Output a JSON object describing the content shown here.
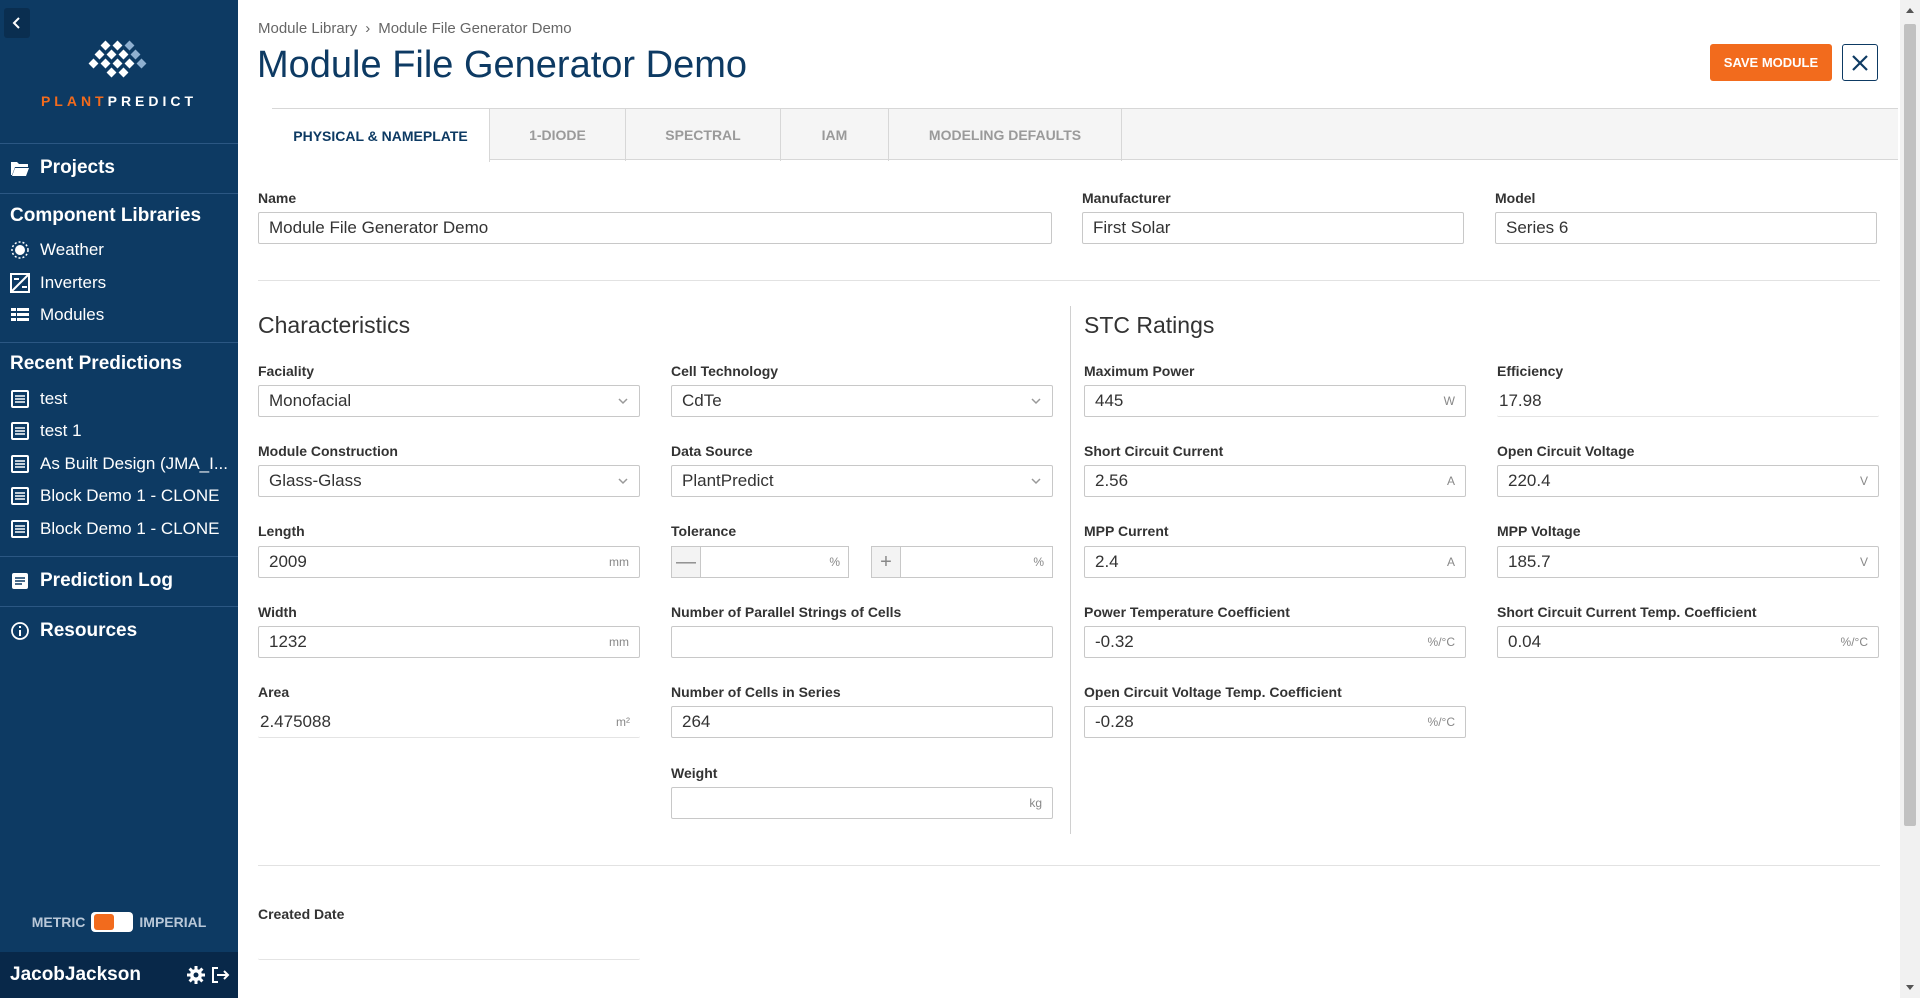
{
  "brand": {
    "name_part1": "PLANT",
    "name_part2": "PREDICT"
  },
  "sidebar": {
    "projects": "Projects",
    "component_libraries": "Component Libraries",
    "libraries": [
      {
        "label": "Weather",
        "icon": "sun-icon"
      },
      {
        "label": "Inverters",
        "icon": "inverter-icon"
      },
      {
        "label": "Modules",
        "icon": "modules-grid-icon"
      }
    ],
    "recent_predictions": "Recent Predictions",
    "recent": [
      "test",
      "test 1",
      "As Built Design (JMA_I...",
      "Block Demo 1 - CLONE",
      "Block Demo 1 - CLONE"
    ],
    "prediction_log": "Prediction Log",
    "resources": "Resources",
    "units": {
      "metric": "METRIC",
      "imperial": "IMPERIAL"
    },
    "user": "JacobJackson"
  },
  "breadcrumb": {
    "root": "Module Library",
    "current": "Module File Generator Demo"
  },
  "page_title": "Module File Generator Demo",
  "actions": {
    "save": "SAVE MODULE"
  },
  "tabs": [
    "PHYSICAL & NAMEPLATE",
    "1-DIODE",
    "SPECTRAL",
    "IAM",
    "MODELING DEFAULTS"
  ],
  "header_fields": {
    "name": {
      "label": "Name",
      "value": "Module File Generator Demo"
    },
    "manufacturer": {
      "label": "Manufacturer",
      "value": "First Solar"
    },
    "model": {
      "label": "Model",
      "value": "Series 6"
    }
  },
  "characteristics": {
    "title": "Characteristics",
    "faciality": {
      "label": "Faciality",
      "value": "Monofacial"
    },
    "cell_technology": {
      "label": "Cell Technology",
      "value": "CdTe"
    },
    "module_construction": {
      "label": "Module Construction",
      "value": "Glass-Glass"
    },
    "data_source": {
      "label": "Data Source",
      "value": "PlantPredict"
    },
    "length": {
      "label": "Length",
      "value": "2009",
      "unit": "mm"
    },
    "tolerance": {
      "label": "Tolerance",
      "unit": "%",
      "minus": "—",
      "plus": "+"
    },
    "width": {
      "label": "Width",
      "value": "1232",
      "unit": "mm"
    },
    "parallel_strings": {
      "label": "Number of Parallel Strings of Cells",
      "value": ""
    },
    "area": {
      "label": "Area",
      "value": "2.475088",
      "unit": "m²"
    },
    "cells_in_series": {
      "label": "Number of Cells in Series",
      "value": "264"
    },
    "weight": {
      "label": "Weight",
      "value": "",
      "unit": "kg"
    }
  },
  "stc": {
    "title": "STC Ratings",
    "max_power": {
      "label": "Maximum Power",
      "value": "445",
      "unit": "W"
    },
    "efficiency": {
      "label": "Efficiency",
      "value": "17.98"
    },
    "isc": {
      "label": "Short Circuit Current",
      "value": "2.56",
      "unit": "A"
    },
    "voc": {
      "label": "Open Circuit Voltage",
      "value": "220.4",
      "unit": "V"
    },
    "impp": {
      "label": "MPP Current",
      "value": "2.4",
      "unit": "A"
    },
    "vmpp": {
      "label": "MPP Voltage",
      "value": "185.7",
      "unit": "V"
    },
    "power_temp_coef": {
      "label": "Power Temperature Coefficient",
      "value": "-0.32",
      "unit": "%/°C"
    },
    "isc_temp_coef": {
      "label": "Short Circuit Current Temp. Coefficient",
      "value": "0.04",
      "unit": "%/°C"
    },
    "voc_temp_coef": {
      "label": "Open Circuit Voltage Temp. Coefficient",
      "value": "-0.28",
      "unit": "%/°C"
    }
  },
  "created_date": {
    "label": "Created Date",
    "value": ""
  },
  "colors": {
    "navy": "#0d3a63",
    "accent": "#f26b1d"
  }
}
